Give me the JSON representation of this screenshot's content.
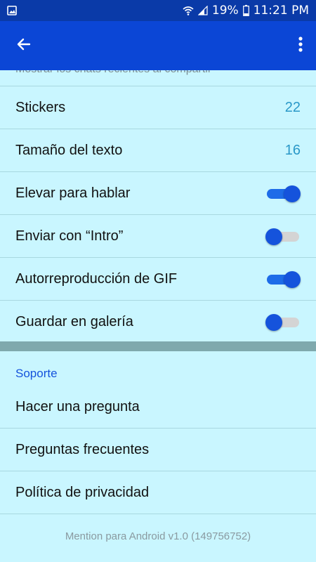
{
  "status_bar": {
    "left_icon": "image-icon",
    "battery": "19%",
    "time": "11:21 PM"
  },
  "app_bar": {
    "back_icon": "back-arrow-icon",
    "more_icon": "more-vert-icon"
  },
  "partial_item": {
    "label": "Mostrar los chats recientes al compartir"
  },
  "settings": [
    {
      "label": "Stickers",
      "value": "22"
    },
    {
      "label": "Tamaño del texto",
      "value": "16"
    },
    {
      "label": "Elevar para hablar",
      "toggle": true
    },
    {
      "label": "Enviar con “Intro”",
      "toggle": false
    },
    {
      "label": "Autorreproducción de GIF",
      "toggle": true
    },
    {
      "label": "Guardar en galería",
      "toggle": false
    }
  ],
  "support": {
    "header": "Soporte",
    "items": [
      {
        "label": "Hacer una pregunta"
      },
      {
        "label": "Preguntas frecuentes"
      },
      {
        "label": "Política de privacidad"
      }
    ]
  },
  "footer": {
    "version": "Mention para Android v1.0 (149756752)"
  },
  "colors": {
    "status_bar": "#0a3aa8",
    "app_bar": "#0b46d6",
    "background": "#c9f6ff",
    "accent": "#1553dc",
    "value_text": "#2a98c8"
  }
}
